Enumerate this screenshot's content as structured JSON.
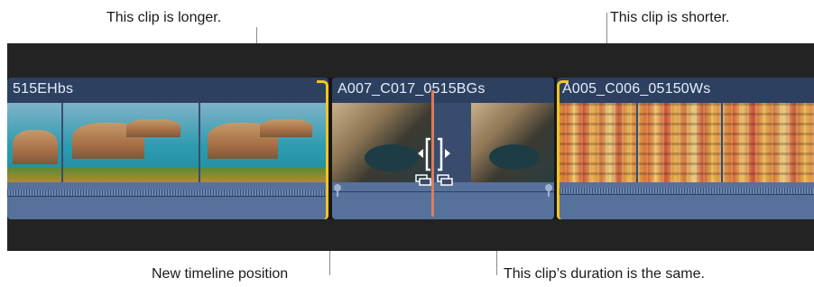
{
  "annotations": {
    "top_left": "This clip is longer.",
    "top_right": "This clip is shorter.",
    "bottom_left": "New timeline position",
    "bottom_right": "This clip’s duration is the same."
  },
  "clips": [
    {
      "name": "515EHbs",
      "scene": "coastal-village-harbor"
    },
    {
      "name": "A007_C017_0515BGs",
      "scene": "rocky-cove-with-boat"
    },
    {
      "name": "A005_C006_05150Ws",
      "scene": "colorful-hillside-houses"
    }
  ],
  "colors": {
    "timeline_background": "#232323",
    "clip_header": "#2d4060",
    "audio_lane": "#55719c",
    "trim_bracket": "#f2c520",
    "playhead": "#e8805a"
  },
  "icons": {
    "roll_edit_cursor": "roll-edit-cursor-icon",
    "audio_keyframe_marker": "audio-marker-icon"
  }
}
